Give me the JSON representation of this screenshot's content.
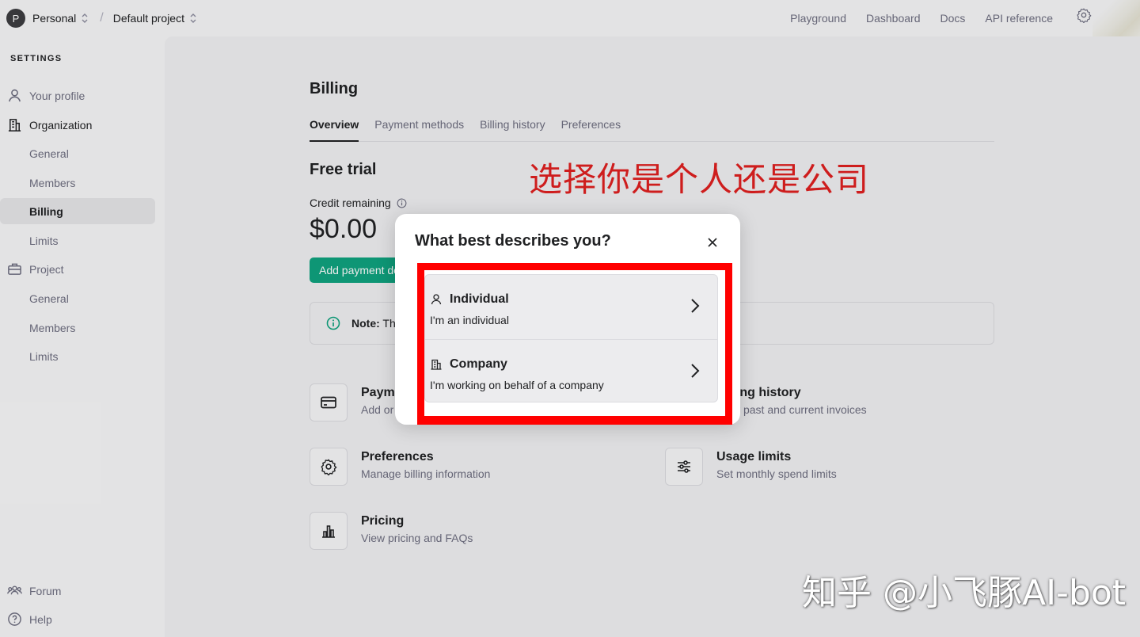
{
  "topbar": {
    "avatar_letter": "P",
    "org": "Personal",
    "project": "Default project",
    "slash": "/",
    "nav": [
      "Playground",
      "Dashboard",
      "Docs",
      "API reference"
    ]
  },
  "sidebar": {
    "section_label": "SETTINGS",
    "items": [
      {
        "label": "Your profile",
        "icon": "person-icon"
      },
      {
        "label": "Organization",
        "icon": "building-icon"
      },
      {
        "label": "General"
      },
      {
        "label": "Members"
      },
      {
        "label": "Billing"
      },
      {
        "label": "Limits"
      },
      {
        "label": "Project",
        "icon": "briefcase-icon"
      },
      {
        "label": "General"
      },
      {
        "label": "Members"
      },
      {
        "label": "Limits"
      }
    ],
    "footer": [
      {
        "label": "Forum",
        "icon": "people-icon"
      },
      {
        "label": "Help",
        "icon": "help-icon"
      }
    ]
  },
  "main": {
    "title": "Billing",
    "tabs": [
      "Overview",
      "Payment methods",
      "Billing history",
      "Preferences"
    ],
    "section_title": "Free trial",
    "credit_label": "Credit remaining",
    "credit_value": "$0.00",
    "add_button": "Add payment details",
    "note_label": "Note:",
    "note_text": "Th",
    "cards": [
      {
        "title": "Payment methods",
        "desc": "Add or change payment method",
        "icon": "credit-card-icon"
      },
      {
        "title": "Billing history",
        "desc": "View past and current invoices",
        "icon": "receipt-icon"
      },
      {
        "title": "Preferences",
        "desc": "Manage billing information",
        "icon": "gear-icon"
      },
      {
        "title": "Usage limits",
        "desc": "Set monthly spend limits",
        "icon": "sliders-icon"
      },
      {
        "title": "Pricing",
        "desc": "View pricing and FAQs",
        "icon": "bar-chart-icon"
      }
    ]
  },
  "annotation": "选择你是个人还是公司",
  "modal": {
    "title": "What best describes you?",
    "options": [
      {
        "title": "Individual",
        "desc": "I'm an individual",
        "icon": "person-icon"
      },
      {
        "title": "Company",
        "desc": "I'm working on behalf of a company",
        "icon": "building-icon"
      }
    ]
  },
  "watermark": "知乎 @小飞豚AI-bot",
  "colors": {
    "accent": "#10a37f",
    "highlight": "#ff0000",
    "annotation": "#e02020"
  }
}
